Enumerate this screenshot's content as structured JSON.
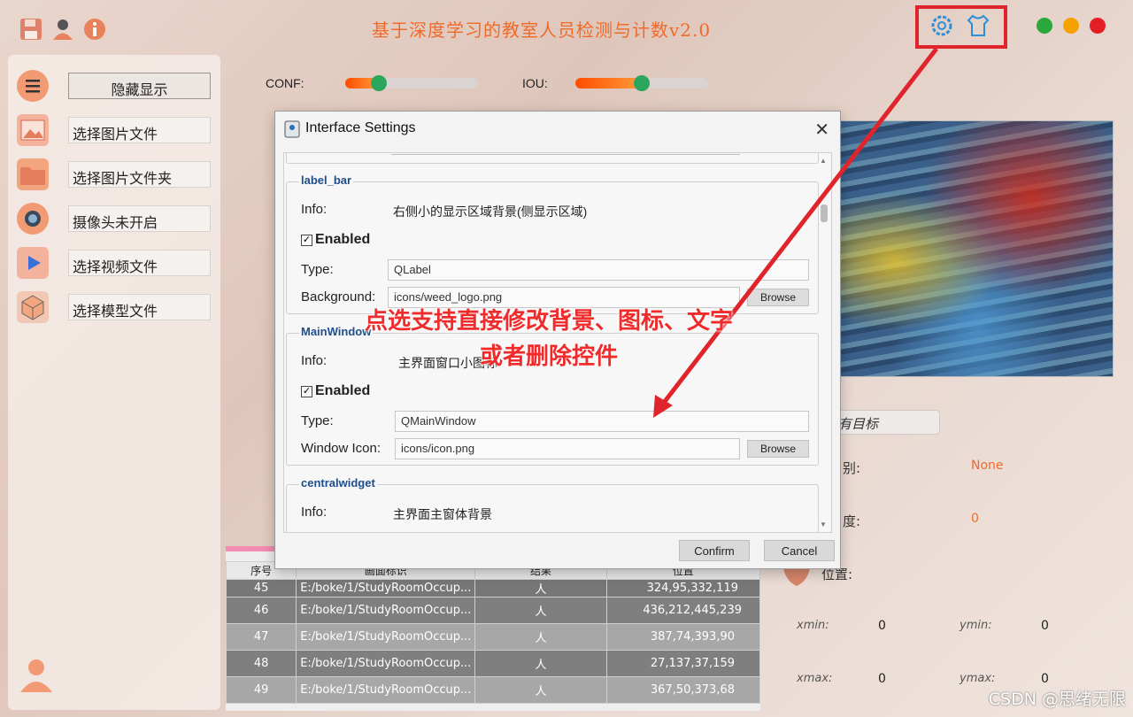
{
  "app": {
    "title": "基于深度学习的教室人员检测与计数v2.0",
    "title_color": "#f06a2a"
  },
  "top_icons": [
    "save-icon",
    "user-icon",
    "info-icon",
    "settings-gear-icon",
    "theme-shirt-icon"
  ],
  "sidebar": {
    "items": [
      {
        "label": "隐藏显示",
        "icon": "menu-icon"
      },
      {
        "label": "选择图片文件",
        "icon": "image-icon"
      },
      {
        "label": "选择图片文件夹",
        "icon": "folder-icon"
      },
      {
        "label": "摄像头未开启",
        "icon": "camera-icon"
      },
      {
        "label": "选择视频文件",
        "icon": "video-play-icon"
      },
      {
        "label": "选择模型文件",
        "icon": "model-cube-icon"
      }
    ]
  },
  "sliders": {
    "conf": {
      "label": "CONF:",
      "value": 0.25
    },
    "iou": {
      "label": "IOU:",
      "value": 0.5
    }
  },
  "right_panel": {
    "target_button": "有目标",
    "type_label": "别:",
    "type_value": "None",
    "conf_label": "度:",
    "conf_value": "0",
    "position_label": "位置:",
    "xmin_label": "xmin:",
    "xmin": "0",
    "ymin_label": "ymin:",
    "ymin": "0",
    "xmax_label": "xmax:",
    "xmax": "0",
    "ymax_label": "ymax:",
    "ymax": "0"
  },
  "table": {
    "headers": [
      "序号",
      "画面标识",
      "结果",
      "位置"
    ],
    "rows": [
      {
        "id": "45",
        "path": "E:/boke/1/StudyRoomOccup...",
        "result": "人",
        "pos": "324,95,332,119"
      },
      {
        "id": "46",
        "path": "E:/boke/1/StudyRoomOccup...",
        "result": "人",
        "pos": "436,212,445,239"
      },
      {
        "id": "47",
        "path": "E:/boke/1/StudyRoomOccup...",
        "result": "人",
        "pos": "387,74,393,90"
      },
      {
        "id": "48",
        "path": "E:/boke/1/StudyRoomOccup...",
        "result": "人",
        "pos": "27,137,37,159"
      },
      {
        "id": "49",
        "path": "E:/boke/1/StudyRoomOccup...",
        "result": "人",
        "pos": "367,50,373,68"
      }
    ]
  },
  "dialog": {
    "title": "Interface Settings",
    "groups": [
      {
        "name": "label_bar",
        "info_label": "Info:",
        "info": "右侧小的显示区域背景(侧显示区域)",
        "enabled_label": "Enabled",
        "type_label": "Type:",
        "type": "QLabel",
        "field_label": "Background:",
        "field_value": "icons/weed_logo.png",
        "browse": "Browse"
      },
      {
        "name": "MainWindow",
        "info_label": "Info:",
        "info": "主界面窗口小图标",
        "enabled_label": "Enabled",
        "type_label": "Type:",
        "type": "QMainWindow",
        "field_label": "Window Icon:",
        "field_value": "icons/icon.png",
        "browse": "Browse"
      },
      {
        "name": "centralwidget",
        "info_label": "Info:",
        "info": "主界面主窗体背景"
      }
    ],
    "confirm": "Confirm",
    "cancel": "Cancel"
  },
  "annotation": {
    "line1": "点选支持直接修改背景、图标、文字",
    "line2": "或者删除控件",
    "color": "#ef2b2b"
  },
  "watermark": "CSDN @思绪无限"
}
